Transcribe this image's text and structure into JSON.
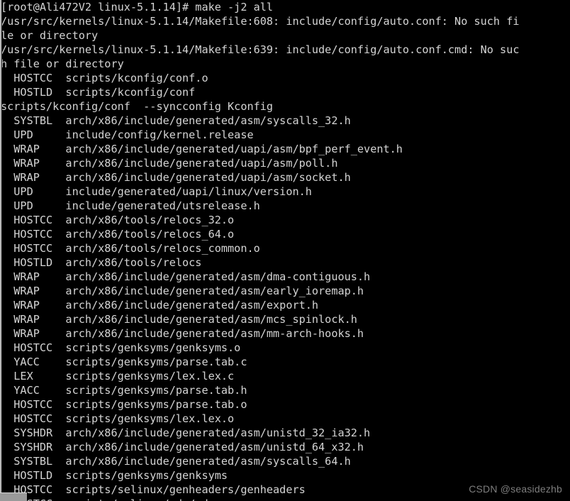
{
  "terminal": {
    "colors": {
      "background": "#000000",
      "foreground": "#d4d4d4",
      "edge": "#b9b9b9",
      "scroll_corner": "#9a9a9a",
      "watermark": "#7e7e7e"
    },
    "prompt": "[root@Ali472V2 linux-5.1.14]#",
    "command": "make -j2 all",
    "lines": [
      "[root@Ali472V2 linux-5.1.14]# make -j2 all",
      "/usr/src/kernels/linux-5.1.14/Makefile:608: include/config/auto.conf: No such fi",
      "le or directory",
      "/usr/src/kernels/linux-5.1.14/Makefile:639: include/config/auto.conf.cmd: No suc",
      "h file or directory",
      "  HOSTCC  scripts/kconfig/conf.o",
      "  HOSTLD  scripts/kconfig/conf",
      "scripts/kconfig/conf  --syncconfig Kconfig",
      "  SYSTBL  arch/x86/include/generated/asm/syscalls_32.h",
      "  UPD     include/config/kernel.release",
      "  WRAP    arch/x86/include/generated/uapi/asm/bpf_perf_event.h",
      "  WRAP    arch/x86/include/generated/uapi/asm/poll.h",
      "  WRAP    arch/x86/include/generated/uapi/asm/socket.h",
      "  UPD     include/generated/uapi/linux/version.h",
      "  UPD     include/generated/utsrelease.h",
      "  HOSTCC  arch/x86/tools/relocs_32.o",
      "  HOSTCC  arch/x86/tools/relocs_64.o",
      "  HOSTCC  arch/x86/tools/relocs_common.o",
      "  HOSTLD  arch/x86/tools/relocs",
      "  WRAP    arch/x86/include/generated/asm/dma-contiguous.h",
      "  WRAP    arch/x86/include/generated/asm/early_ioremap.h",
      "  WRAP    arch/x86/include/generated/asm/export.h",
      "  WRAP    arch/x86/include/generated/asm/mcs_spinlock.h",
      "  WRAP    arch/x86/include/generated/asm/mm-arch-hooks.h",
      "  HOSTCC  scripts/genksyms/genksyms.o",
      "  YACC    scripts/genksyms/parse.tab.c",
      "  LEX     scripts/genksyms/lex.lex.c",
      "  YACC    scripts/genksyms/parse.tab.h",
      "  HOSTCC  scripts/genksyms/parse.tab.o",
      "  HOSTCC  scripts/genksyms/lex.lex.o",
      "  SYSHDR  arch/x86/include/generated/asm/unistd_32_ia32.h",
      "  SYSHDR  arch/x86/include/generated/asm/unistd_64_x32.h",
      "  SYSTBL  arch/x86/include/generated/asm/syscalls_64.h",
      "  HOSTLD  scripts/genksyms/genksyms",
      "  HOSTCC  scripts/selinux/genheaders/genheaders",
      "  HOSTCC  scripts/selinux/mdp/mdp"
    ]
  },
  "watermark": {
    "text": "CSDN @seasidezhb"
  }
}
